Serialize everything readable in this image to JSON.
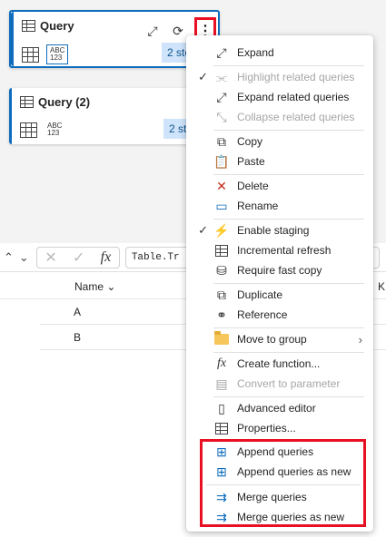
{
  "cards": [
    {
      "title": "Query",
      "type_top": "ABC",
      "type_bottom": "123",
      "steps": "2 ste"
    },
    {
      "title": "Query (2)",
      "type_top": "ABC",
      "type_bottom": "123",
      "steps": "2 ste"
    }
  ],
  "formula": {
    "text": "Table.Tr",
    "text_tail": "\","
  },
  "grid": {
    "columns": [
      "Name",
      "K"
    ],
    "rows": [
      "A",
      "B"
    ]
  },
  "menu": {
    "items": [
      {
        "label": "Expand",
        "icon": "expand-icon",
        "checked": false,
        "disabled": false
      },
      {
        "label": "Highlight related queries",
        "icon": "related-icon",
        "checked": true,
        "disabled": true
      },
      {
        "label": "Expand related queries",
        "icon": "expand-icon",
        "checked": false,
        "disabled": false
      },
      {
        "label": "Collapse related queries",
        "icon": "collapse-icon",
        "checked": false,
        "disabled": true
      },
      {
        "label": "Copy",
        "icon": "copy-icon",
        "checked": false,
        "disabled": false
      },
      {
        "label": "Paste",
        "icon": "paste-icon",
        "checked": false,
        "disabled": false
      },
      {
        "label": "Delete",
        "icon": "delete-icon",
        "checked": false,
        "disabled": false
      },
      {
        "label": "Rename",
        "icon": "rename-icon",
        "checked": false,
        "disabled": false
      },
      {
        "label": "Enable staging",
        "icon": "bolt-icon",
        "checked": true,
        "disabled": false
      },
      {
        "label": "Incremental refresh",
        "icon": "table-icon",
        "checked": false,
        "disabled": false
      },
      {
        "label": "Require fast copy",
        "icon": "database-icon",
        "checked": false,
        "disabled": false
      },
      {
        "label": "Duplicate",
        "icon": "duplicate-icon",
        "checked": false,
        "disabled": false
      },
      {
        "label": "Reference",
        "icon": "reference-icon",
        "checked": false,
        "disabled": false
      },
      {
        "label": "Move to group",
        "icon": "folder-icon",
        "checked": false,
        "disabled": false
      },
      {
        "label": "Create function...",
        "icon": "function-icon",
        "checked": false,
        "disabled": false
      },
      {
        "label": "Convert to parameter",
        "icon": "parameter-icon",
        "checked": false,
        "disabled": true
      },
      {
        "label": "Advanced editor",
        "icon": "editor-icon",
        "checked": false,
        "disabled": false
      },
      {
        "label": "Properties...",
        "icon": "properties-icon",
        "checked": false,
        "disabled": false
      },
      {
        "label": "Append queries",
        "icon": "append-icon",
        "checked": false,
        "disabled": false
      },
      {
        "label": "Append queries as new",
        "icon": "append-new-icon",
        "checked": false,
        "disabled": false
      },
      {
        "label": "Merge queries",
        "icon": "merge-icon",
        "checked": false,
        "disabled": false
      },
      {
        "label": "Merge queries as new",
        "icon": "merge-new-icon",
        "checked": false,
        "disabled": false
      }
    ]
  },
  "colors": {
    "accent": "#0f6cbd",
    "highlight": "#e81123",
    "badge": "#cfe4fa"
  }
}
